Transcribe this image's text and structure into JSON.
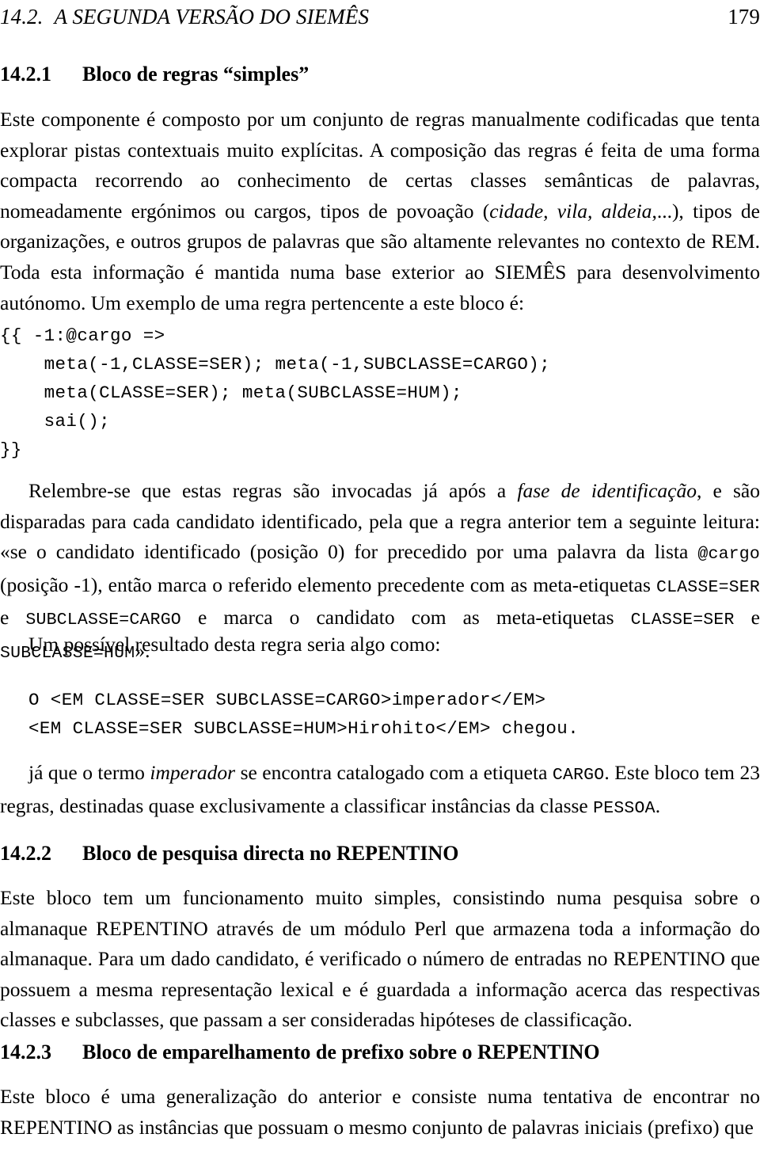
{
  "page": {
    "number": "179",
    "running_head": {
      "section_number": "14.2.",
      "title": "A SEGUNDA VERSÃO DO SIEMÊS"
    }
  },
  "sections": [
    {
      "number": "14.2.1",
      "title": "Bloco de regras “simples”",
      "paragraph_1": {
        "run_1": "Este componente é composto por um conjunto de regras manualmente codificadas que tenta explorar pistas contextuais muito explícitas. A composição das regras é feita de uma forma compacta recorrendo ao conhecimento de certas classes semânticas de palavras, nomeadamente ergónimos ou cargos, tipos de povoação (",
        "run_2_italic": "cidade, vila, aldeia",
        "run_3": ",...), tipos de organizações, e outros grupos de palavras que são altamente relevantes no contexto de REM. Toda esta informação é mantida numa base exterior ao SIEMÊS para desenvolvimento autónomo. Um exemplo de uma regra pertencente a este bloco é:"
      },
      "code_block_1": "{{ -1:@cargo =>\n    meta(-1,CLASSE=SER); meta(-1,SUBCLASSE=CARGO);\n    meta(CLASSE=SER); meta(SUBCLASSE=HUM);\n    sai();\n}}",
      "paragraph_2": {
        "run_1": "Relembre-se que estas regras são invocadas já após a ",
        "run_2_italic": "fase de identificação",
        "run_3": ", e são disparadas para cada candidato identificado, pela que a regra anterior tem a seguinte leitura: «se o candidato identificado (posição 0) for precedido por uma palavra da lista ",
        "run_4_code": "@cargo",
        "run_5": " (posição -1), então marca o referido elemento precedente com as meta-etiquetas ",
        "run_6_code": "CLASSE=SER",
        "run_7": " e ",
        "run_8_code": "SUBCLASSE=CARGO",
        "run_9": " e marca o candidato com as meta-etiquetas ",
        "run_10_code": "CLASSE=SER",
        "run_11": " e ",
        "run_12_code": "SUBCLASSE=HUM",
        "run_13": "»."
      },
      "paragraph_3": "Um possível resultado desta regra seria algo como:",
      "code_block_2": "O <EM CLASSE=SER SUBCLASSE=CARGO>imperador</EM>\n<EM CLASSE=SER SUBCLASSE=HUM>Hirohito</EM> chegou.",
      "paragraph_4": {
        "run_1": "já que o termo ",
        "run_2_italic": "imperador",
        "run_3": " se encontra catalogado com a etiqueta ",
        "run_4_code": "CARGO",
        "run_5": ". Este bloco tem 23 regras, destinadas quase exclusivamente a classificar instâncias da classe ",
        "run_6_code": "PESSOA",
        "run_7": "."
      }
    },
    {
      "number": "14.2.2",
      "title": "Bloco de pesquisa directa no REPENTINO",
      "paragraph_1": "Este bloco tem um funcionamento muito simples, consistindo numa pesquisa sobre o almanaque REPENTINO através de um módulo Perl que armazena toda a informação do almanaque. Para um dado candidato, é verificado o número de entradas no REPENTINO que possuem a mesma representação lexical e é guardada a informação acerca das respectivas classes e subclasses, que passam a ser consideradas hipóteses de classificação."
    },
    {
      "number": "14.2.3",
      "title": "Bloco de emparelhamento de prefixo sobre o REPENTINO",
      "paragraph_1": "Este bloco é uma generalização do anterior e consiste numa tentativa de encontrar no REPENTINO as instâncias que possuam o mesmo conjunto de palavras iniciais (prefixo) que"
    }
  ]
}
